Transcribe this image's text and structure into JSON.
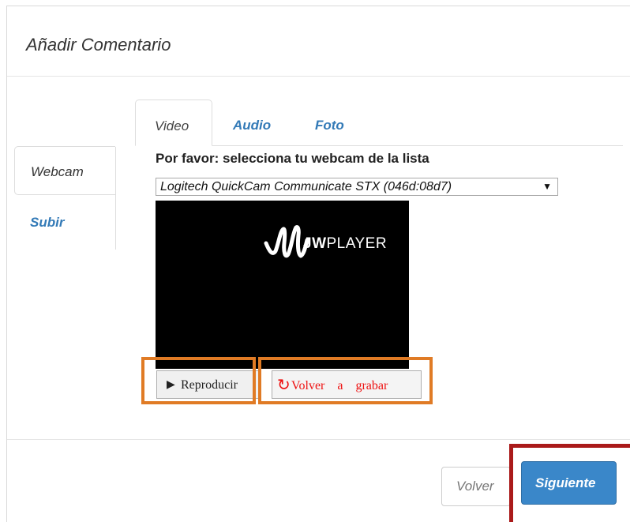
{
  "modal": {
    "title": "Añadir Comentario"
  },
  "side_tabs": {
    "webcam": "Webcam",
    "subir": "Subir"
  },
  "media_tabs": {
    "video": "Video",
    "audio": "Audio",
    "foto": "Foto"
  },
  "webcam": {
    "prompt": "Por favor: selecciona tu webcam de la lista",
    "selected_device": "Logitech QuickCam Communicate STX (046d:08d7)"
  },
  "player": {
    "brand_bold": "JW",
    "brand_rest": "PLAYER",
    "logo_icon": "jwplayer-logo-icon"
  },
  "controls": {
    "play_icon": "▶",
    "play_label": "Reproducir",
    "rerecord_icon": "↻",
    "rerecord_label": "Volver a grabar"
  },
  "footer": {
    "back_label": "Volver",
    "next_label": "Siguiente"
  },
  "colors": {
    "link": "#337ab7",
    "primary": "#3a87c9",
    "highlight_orange": "#e07b25",
    "highlight_red": "#aa1a1a",
    "rerecord_text": "#ee1111"
  }
}
